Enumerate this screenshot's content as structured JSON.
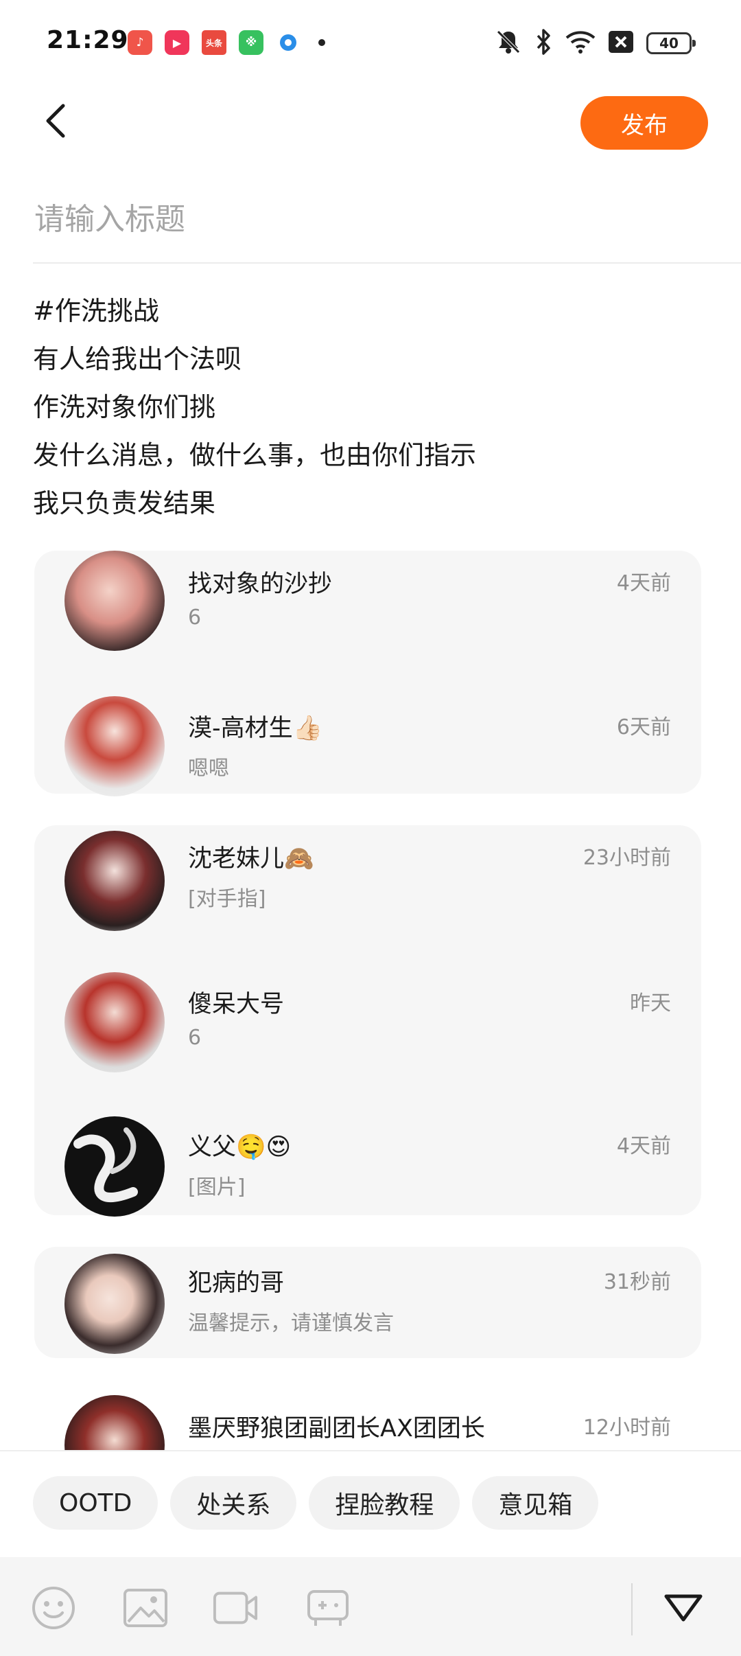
{
  "status_bar": {
    "time": "21:29",
    "apps": [
      {
        "icon": "music-app-icon",
        "color": "#f0554a",
        "glyph": "♪"
      },
      {
        "icon": "video-app-icon",
        "color": "#f0365a",
        "glyph": "▶"
      },
      {
        "icon": "toutiao-app-icon",
        "color": "#e94a3f",
        "glyph": "头条"
      },
      {
        "icon": "green-app-icon",
        "color": "#37c15f",
        "glyph": "※"
      },
      {
        "icon": "browser-app-icon",
        "color": "#2a8ee8",
        "glyph": "●"
      }
    ],
    "battery": "40",
    "icons": [
      "mute-icon",
      "bluetooth-icon",
      "wifi-icon",
      "sim-off-icon"
    ]
  },
  "header": {
    "publish_label": "发布"
  },
  "editor": {
    "title_placeholder": "请输入标题",
    "body_lines": [
      "#作洗挑战",
      "有人给我出个法呗",
      "作洗对象你们挑",
      "发什么消息，做什么事，也由你们指示",
      "我只负责发结果"
    ]
  },
  "chat_groups": [
    {
      "items": [
        {
          "name": "找对象的沙抄",
          "preview": "6",
          "time": "4天前"
        },
        {
          "name": "漠-高材生👍🏻",
          "preview": "嗯嗯",
          "time": "6天前"
        }
      ]
    },
    {
      "items": [
        {
          "name": "沈老妹儿🙈",
          "preview": "[对手指]",
          "time": "23小时前"
        },
        {
          "name": "傻呆大号",
          "preview": "6",
          "time": "昨天"
        },
        {
          "name": "义父🤤😍",
          "preview": "[图片]",
          "time": "4天前"
        }
      ]
    },
    {
      "items": [
        {
          "name": "犯病的哥",
          "preview": "温馨提示，请谨慎发言",
          "time": "31秒前"
        }
      ]
    }
  ],
  "partial_item": {
    "name": "墨厌野狼团副团长AX团团长",
    "time": "12小时前"
  },
  "topics": [
    "OOTD",
    "处关系",
    "捏脸教程",
    "意见箱"
  ],
  "toolbar": {
    "icons": [
      "emoji-icon",
      "image-icon",
      "video-icon",
      "game-controller-icon",
      "collapse-icon"
    ]
  }
}
